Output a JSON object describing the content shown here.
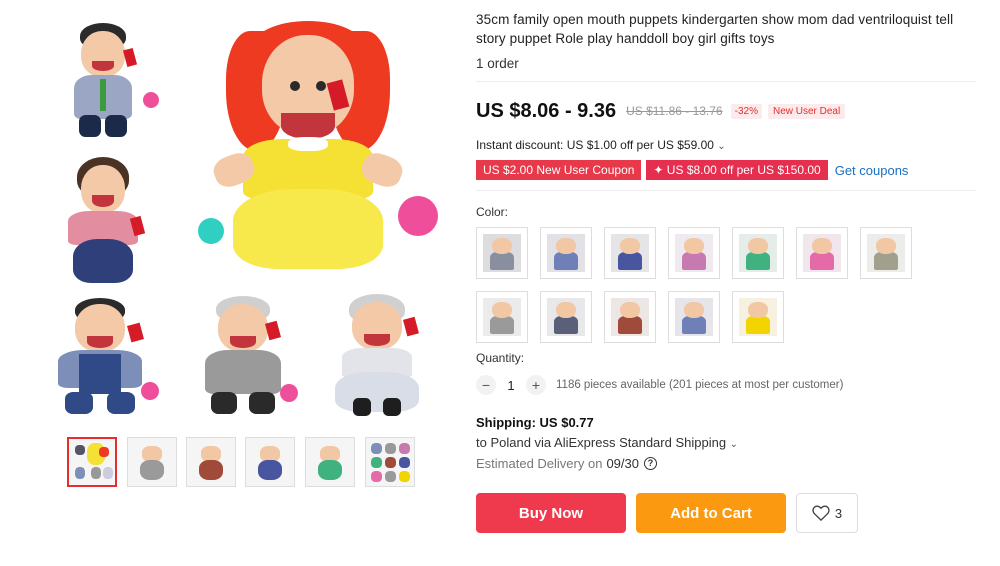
{
  "product": {
    "title": "35cm family open mouth puppets kindergarten show mom dad ventriloquist tell story puppet Role play handdoll boy girl gifts toys",
    "orders": "1 order"
  },
  "price": {
    "current": "US $8.06 - 9.36",
    "original": "US $11.86 - 13.76",
    "discount": "-32%",
    "badge": "New User Deal"
  },
  "discounts": {
    "instant": "Instant discount: US $1.00 off per US $59.00",
    "coupons": [
      "US $2.00 New User Coupon",
      "✦ US $8.00 off per US $150.00"
    ],
    "get_coupons": "Get coupons"
  },
  "color": {
    "label": "Color:",
    "options": [
      {
        "body": "#8a8fa0",
        "bg": "#dddde0"
      },
      {
        "body": "#6f7fb8",
        "bg": "#e2e2e6"
      },
      {
        "body": "#4a55a0",
        "bg": "#e5e5e8"
      },
      {
        "body": "#c77ab0",
        "bg": "#eeeaf0"
      },
      {
        "body": "#3fb27f",
        "bg": "#e6ece8"
      },
      {
        "body": "#e56aa8",
        "bg": "#f0e6ec"
      },
      {
        "body": "#a0a08c",
        "bg": "#ececea"
      },
      {
        "body": "#9a9a9a",
        "bg": "#ebebeb"
      },
      {
        "body": "#5a5f7a",
        "bg": "#e8e8ea"
      },
      {
        "body": "#a04a3a",
        "bg": "#ece6e4"
      },
      {
        "body": "#6f7fb8",
        "bg": "#e6e6ea"
      },
      {
        "body": "#f2d400",
        "bg": "#f6f1e0"
      }
    ]
  },
  "quantity": {
    "label": "Quantity:",
    "value": "1",
    "minus": "−",
    "plus": "+",
    "available": "1186 pieces available (201 pieces at most per customer)"
  },
  "shipping": {
    "title": "Shipping: US $0.77",
    "route": "to Poland via AliExpress Standard Shipping",
    "estimated_label": "Estimated Delivery on",
    "estimated_date": "09/30"
  },
  "actions": {
    "buy_now": "Buy Now",
    "add_to_cart": "Add to Cart",
    "wishlist_count": "3"
  },
  "icons": {
    "chevron": "⌄",
    "help": "?",
    "heart": "heart-icon"
  }
}
